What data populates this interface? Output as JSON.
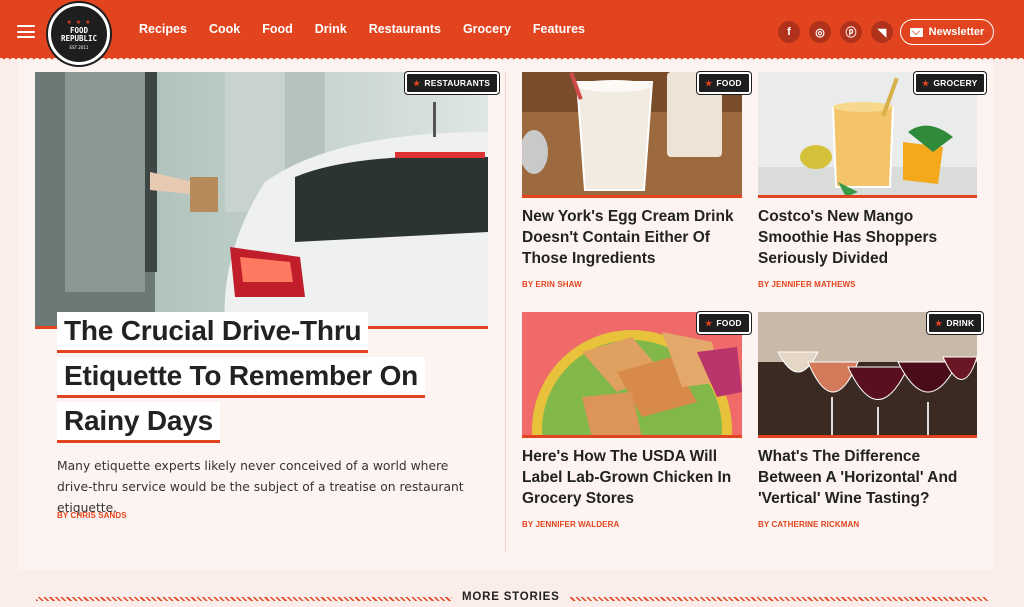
{
  "header": {
    "logo": {
      "line1": "FOOD",
      "line2": "REPUBLIC",
      "est": "EST 2011",
      "stars": "★ ★ ★"
    },
    "nav": [
      "Recipes",
      "Cook",
      "Food",
      "Drink",
      "Restaurants",
      "Grocery",
      "Features"
    ],
    "social": [
      {
        "icon": "facebook-icon",
        "glyph": "f"
      },
      {
        "icon": "instagram-icon",
        "glyph": "◎"
      },
      {
        "icon": "pinterest-icon",
        "glyph": "ⓟ"
      },
      {
        "icon": "rss-icon",
        "glyph": "◥"
      }
    ],
    "newsletter_label": "Newsletter"
  },
  "hero": {
    "tag": "RESTAURANTS",
    "title": "The Crucial Drive-Thru Etiquette To Remember On Rainy Days",
    "description": "Many etiquette experts likely never conceived of a world where drive-thru service would be the subject of a treatise on restaurant etiquette.",
    "byline": "BY CHRIS SANDS"
  },
  "articles": [
    {
      "tag": "FOOD",
      "title": "New York's Egg Cream Drink Doesn't Contain Either Of Those Ingredients",
      "byline": "BY ERIN SHAW"
    },
    {
      "tag": "GROCERY",
      "title": "Costco's New Mango Smoothie Has Shoppers Seriously Divided",
      "byline": "BY JENNIFER MATHEWS"
    },
    {
      "tag": "FOOD",
      "title": "Here's How The USDA Will Label Lab-Grown Chicken In Grocery Stores",
      "byline": "BY JENNIFER WALDERA"
    },
    {
      "tag": "DRINK",
      "title": "What's The Difference Between A 'Horizontal' And 'Vertical' Wine Tasting?",
      "byline": "BY CATHERINE RICKMAN"
    }
  ],
  "more_stories_label": "MORE STORIES",
  "colors": {
    "brand": "#e1441e",
    "dark": "#1e1e1e",
    "background": "#fbeeea"
  }
}
